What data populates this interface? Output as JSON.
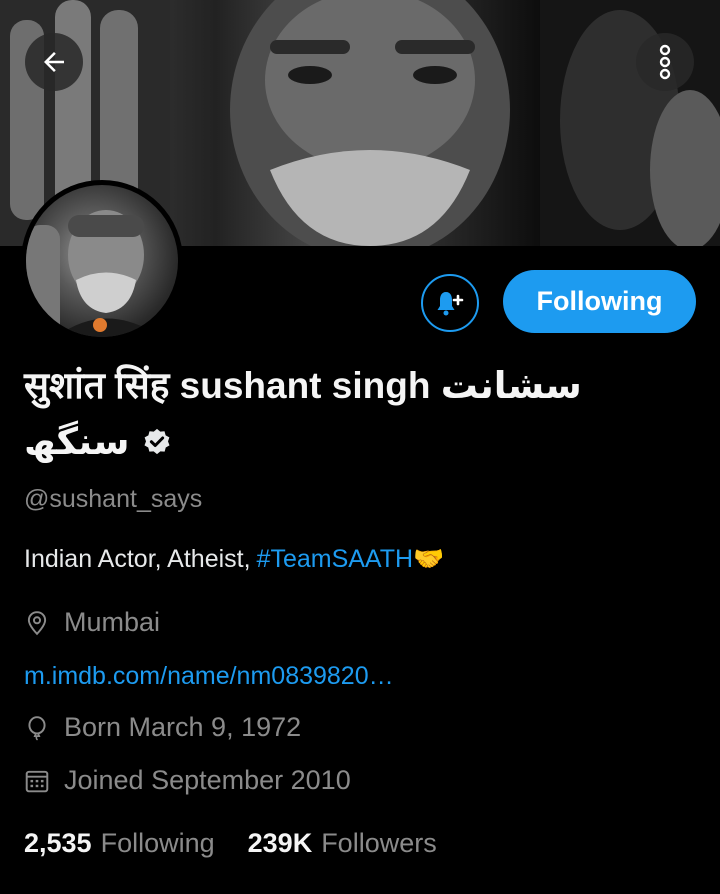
{
  "profile": {
    "name_line1": "सुशांत सिंह sushant singh سشانت",
    "name_line2": "سنگھ",
    "handle": "@sushant_says",
    "bio_text": "Indian Actor, Atheist,",
    "bio_hashtag": "#TeamSAATH",
    "bio_emoji": "🤝",
    "location": "Mumbai",
    "website": "m.imdb.com/name/nm0839820…",
    "born": "Born March 9, 1972",
    "joined": "Joined September 2010"
  },
  "stats": {
    "following_count": "2,535",
    "following_label": "Following",
    "followers_count": "239K",
    "followers_label": "Followers"
  },
  "actions": {
    "follow_state_label": "Following"
  },
  "colors": {
    "accent": "#1d9bf0",
    "background": "#000000",
    "secondary_text": "#8b8b8b"
  }
}
